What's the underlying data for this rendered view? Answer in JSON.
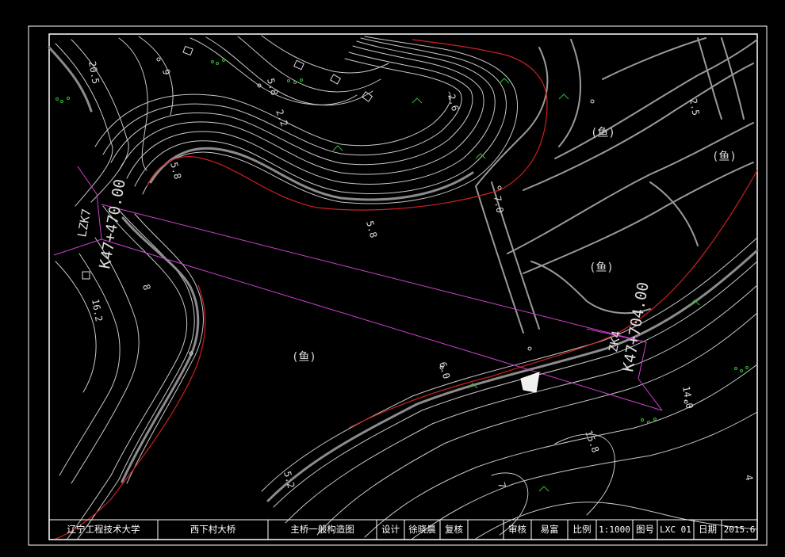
{
  "drawing": {
    "background": "#000000",
    "frame_color": "#ffffff",
    "contour_color": "#c8c8c8",
    "index_contour_color": "#8c8c8c",
    "boundary_color": "#cc2020",
    "alignment_color": "#d040d0",
    "vegetation_color": "#2fbf2f"
  },
  "stations": {
    "start_name": "LZK7",
    "start_value": "K47+470.00",
    "end_name": "ZK4",
    "end_value": "K47+704.00"
  },
  "contour_labels": [
    "20.5",
    "9",
    "5.8",
    "2.2",
    "5.8",
    "5.8",
    "7.0",
    "2.6",
    "16.2",
    "8",
    "6.0",
    "14.0",
    "15.8",
    "5.2",
    "7",
    "4",
    "2.5"
  ],
  "map_symbols": [
    "(鱼)",
    "(鱼)",
    "(鱼)",
    "(鱼)"
  ],
  "title_block": {
    "school": "辽宁工程技术大学",
    "project": "西下村大桥",
    "drawing_title": "主桥一般构造图",
    "design_label": "设计",
    "designer": "徐晓晨",
    "review_label": "复核",
    "reviewer": "",
    "audit_label": "审核",
    "auditor": "易富",
    "scale_label": "比例",
    "scale_value": "1:1000",
    "drawing_no_label": "图号",
    "drawing_no": "LXC 01",
    "date_label": "日期",
    "date_value": "2015.6"
  }
}
